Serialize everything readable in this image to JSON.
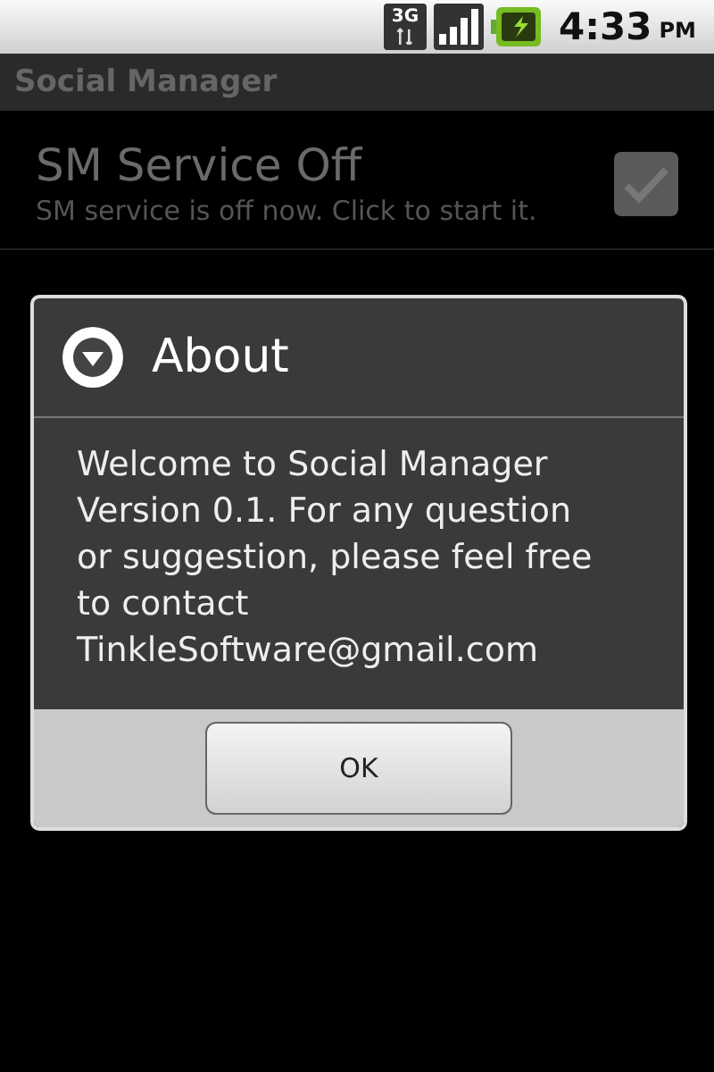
{
  "status_bar": {
    "time": "4:33",
    "meridiem": "PM",
    "network": "3G"
  },
  "app_title": "Social Manager",
  "settings": [
    {
      "title": "SM Service Off",
      "summary": "SM service is off now. Click to start it.",
      "checked": true
    }
  ],
  "dialog": {
    "title": "About",
    "message": "Welcome to Social Manager Version 0.1. For any question or suggestion, please feel free to contact TinkleSoftware@gmail.com",
    "buttons": [
      "OK"
    ]
  }
}
